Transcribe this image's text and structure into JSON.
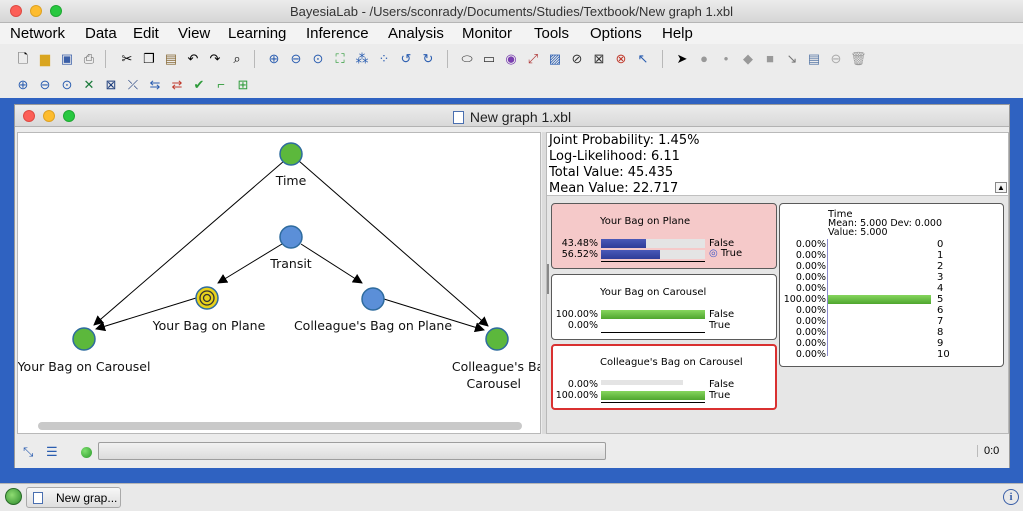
{
  "app": {
    "title": "BayesiaLab - /Users/sconrady/Documents/Studies/Textbook/New graph 1.xbl"
  },
  "menu": [
    "Network",
    "Data",
    "Edit",
    "View",
    "Learning",
    "Inference",
    "Analysis",
    "Monitor",
    "Tools",
    "Options",
    "Help"
  ],
  "window": {
    "title": "New graph 1.xbl"
  },
  "graph": {
    "nodes": {
      "time": "Time",
      "transit": "Transit",
      "your_bag_on_plane": "Your Bag on Plane",
      "colleagues_bag_on_plane": "Colleague's Bag on Plane",
      "your_bag_on_carousel": "Your Bag on Carousel",
      "colleagues_bag_carousel_1": "Colleague's Bag",
      "colleagues_bag_carousel_2": "Carousel"
    },
    "colors": {
      "node_green": "#5cb83c",
      "node_blue": "#5b8fd8",
      "target_yellow": "#e8d21b"
    }
  },
  "stats": {
    "joint_probability": "Joint Probability: 1.45%",
    "log_likelihood": "Log-Likelihood: 6.11",
    "total_value": "Total Value: 45.435",
    "mean_value": "Mean Value: 22.717"
  },
  "monitors": {
    "your_bag_on_plane": {
      "name": "Your Bag on Plane",
      "states": [
        {
          "label": "False",
          "pct": "43.48%",
          "value": 0.4348
        },
        {
          "label": "True",
          "pct": "56.52%",
          "value": 0.5652
        }
      ]
    },
    "your_bag_on_carousel": {
      "name": "Your Bag on Carousel",
      "states": [
        {
          "label": "False",
          "pct": "100.00%",
          "value": 1.0
        },
        {
          "label": "True",
          "pct": "0.00%",
          "value": 0.0
        }
      ]
    },
    "colleagues_bag_on_carousel": {
      "name": "Colleague's Bag on Carousel",
      "states": [
        {
          "label": "False",
          "pct": "0.00%",
          "value": 0.0
        },
        {
          "label": "True",
          "pct": "100.00%",
          "value": 1.0
        }
      ]
    },
    "time": {
      "name": "Time",
      "mean_line": "Mean: 5.000 Dev: 0.000",
      "value_line": "Value: 5.000",
      "states": [
        {
          "label": "0",
          "pct": "0.00%",
          "value": 0
        },
        {
          "label": "1",
          "pct": "0.00%",
          "value": 0
        },
        {
          "label": "2",
          "pct": "0.00%",
          "value": 0
        },
        {
          "label": "3",
          "pct": "0.00%",
          "value": 0
        },
        {
          "label": "4",
          "pct": "0.00%",
          "value": 0
        },
        {
          "label": "5",
          "pct": "100.00%",
          "value": 1
        },
        {
          "label": "6",
          "pct": "0.00%",
          "value": 0
        },
        {
          "label": "7",
          "pct": "0.00%",
          "value": 0
        },
        {
          "label": "8",
          "pct": "0.00%",
          "value": 0
        },
        {
          "label": "9",
          "pct": "0.00%",
          "value": 0
        },
        {
          "label": "10",
          "pct": "0.00%",
          "value": 0
        }
      ]
    }
  },
  "statusbar": {
    "position": "0:0"
  },
  "taskbar": {
    "item": "New grap..."
  }
}
